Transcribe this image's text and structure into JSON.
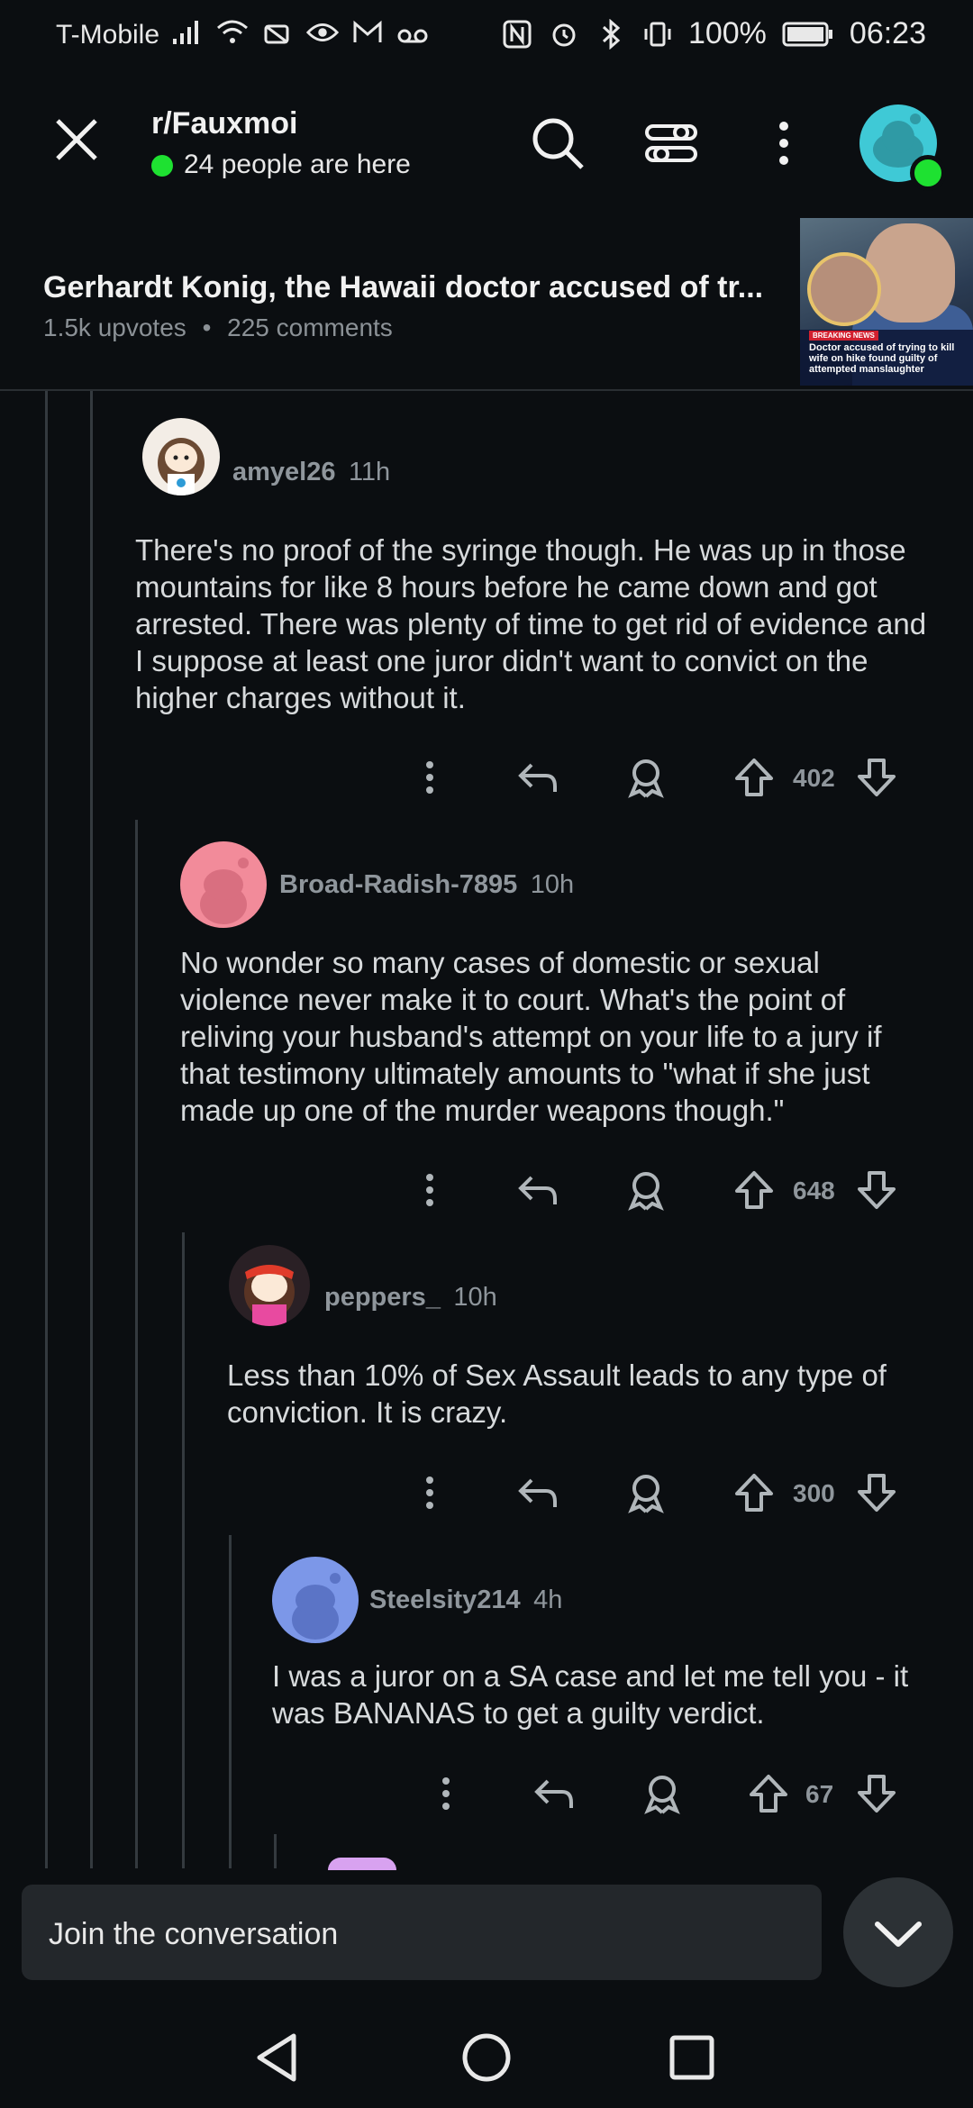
{
  "status_bar": {
    "carrier": "T-Mobile",
    "battery": "100%",
    "time": "06:23"
  },
  "header": {
    "subreddit": "r/Fauxmoi",
    "online": "24 people are here",
    "icons": [
      "close-icon",
      "search-icon",
      "filter-icon",
      "more-icon",
      "avatar"
    ]
  },
  "post": {
    "title": "Gerhardt Konig, the Hawaii doctor accused of tr...",
    "upvotes": "1.5k upvotes",
    "separator": "•",
    "comments": "225 comments",
    "thumbnail": {
      "tag": "BREAKING NEWS",
      "caption": "Doctor accused of trying to kill wife on hike found guilty of attempted manslaughter"
    }
  },
  "comments": [
    {
      "username": "amyel26",
      "time": "11h",
      "body": "There's no proof of the syringe though. He was up in those mountains for like 8 hours before he came down and got arrested. There was plenty of time to get rid of evidence and I suppose at least one juror didn't want to convict on the higher charges without it.",
      "votes": "402"
    },
    {
      "username": "Broad-Radish-7895",
      "time": "10h",
      "body": "No wonder so many cases of domestic or sexual violence never make it to court. What's the point of reliving your husband's attempt on your life to a jury if that testimony ultimately amounts to \"what if she just made up one of the murder weapons though.\"",
      "votes": "648"
    },
    {
      "username": "peppers_",
      "time": "10h",
      "body": "Less than 10% of Sex Assault leads to any type of conviction. It is crazy.",
      "votes": "300"
    },
    {
      "username": "Steelsity214",
      "time": "4h",
      "body": "I was a juror on a SA case and let me tell you - it was BANANAS to get a guilty verdict.",
      "votes": "67"
    }
  ],
  "bottom": {
    "join_placeholder": "Join the conversation"
  },
  "colors": {
    "background": "#0b0e11",
    "online": "#1ee131",
    "text": "#d7dadc",
    "muted": "#8f969c"
  }
}
